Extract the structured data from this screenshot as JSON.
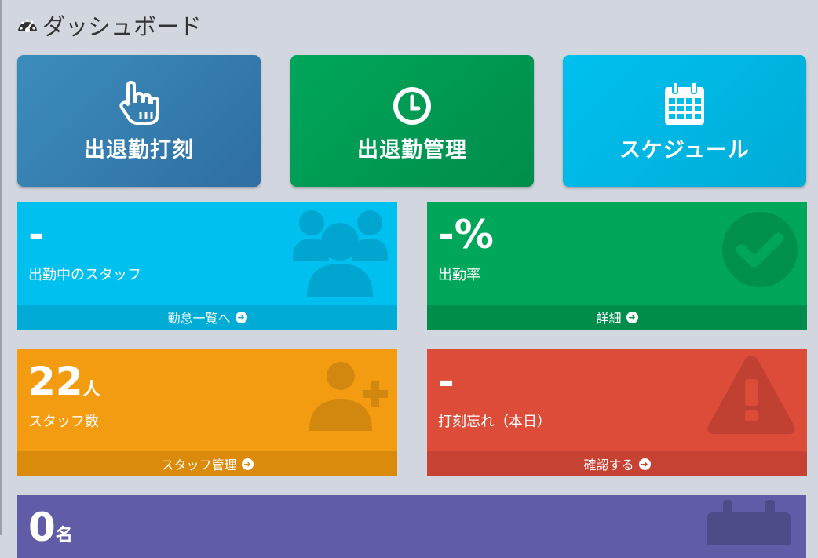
{
  "header": {
    "title": "ダッシュボード",
    "icon": "dashboard-icon"
  },
  "tiles": [
    {
      "label": "出退勤打刻",
      "icon": "hand-pointer-icon",
      "color": "#3c8dbc"
    },
    {
      "label": "出退勤管理",
      "icon": "clock-icon",
      "color": "#00a65a"
    },
    {
      "label": "スケジュール",
      "icon": "calendar-icon",
      "color": "#00c0ef"
    }
  ],
  "boxes": {
    "working_staff": {
      "value": "-",
      "caption": "出勤中のスタッフ",
      "footer": "勤怠一覧へ",
      "icon": "users-icon",
      "color": "#00c0ef"
    },
    "attendance_rate": {
      "value": "-%",
      "caption": "出勤率",
      "footer": "詳細",
      "icon": "check-circle-icon",
      "color": "#00a65a"
    },
    "staff_count": {
      "value": "22",
      "unit": "人",
      "caption": "スタッフ数",
      "footer": "スタッフ管理",
      "icon": "user-plus-icon",
      "color": "#f39c12"
    },
    "forgot_punch": {
      "value": "-",
      "caption": "打刻忘れ（本日）",
      "footer": "確認する",
      "icon": "warning-icon",
      "color": "#dd4b39"
    },
    "bottom": {
      "value": "0",
      "unit": "名",
      "icon": "calendar-icon",
      "color": "#605ca8"
    }
  }
}
